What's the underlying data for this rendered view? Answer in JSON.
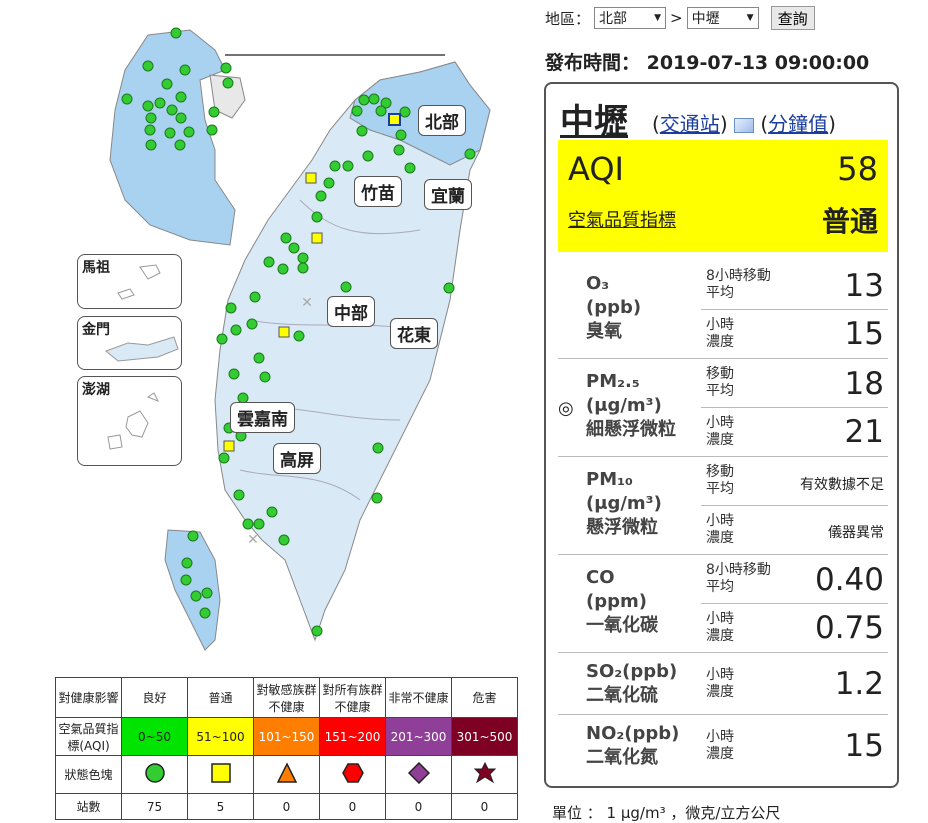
{
  "query": {
    "region_label": "地區：",
    "region_value": "北部",
    "separator": ">",
    "station_value": "中壢",
    "submit_label": "查詢"
  },
  "published": "發布時間： 2019-07-13 09:00:00",
  "map": {
    "regions": [
      "北部",
      "竹苗",
      "宜蘭",
      "中部",
      "花東",
      "雲嘉南",
      "高屏"
    ],
    "insets": [
      "馬祖",
      "金門",
      "澎湖"
    ]
  },
  "legend": {
    "header_health": "對健康影響",
    "header_aqi": "空氣品質指標(AQI)",
    "header_shape": "狀態色塊",
    "header_count": "站數",
    "levels": [
      {
        "name": "良好",
        "range": "0~50",
        "color": "#00e400",
        "shape": "circle",
        "count": "75"
      },
      {
        "name": "普通",
        "range": "51~100",
        "color": "#ffff00",
        "shape": "square",
        "count": "5"
      },
      {
        "name": "對敏感族群不健康",
        "range": "101~150",
        "color": "#ff7e00",
        "shape": "triangle",
        "count": "0"
      },
      {
        "name": "對所有族群不健康",
        "range": "151~200",
        "color": "#ff0000",
        "shape": "hexagon",
        "count": "0"
      },
      {
        "name": "非常不健康",
        "range": "201~300",
        "color": "#8f3f97",
        "shape": "diamond",
        "count": "0"
      },
      {
        "name": "危害",
        "range": "301~500",
        "color": "#7e0023",
        "shape": "star",
        "count": "0"
      }
    ]
  },
  "station": {
    "name": "中壢",
    "link_traffic": "交通站",
    "link_minute": "分鐘值",
    "aqi_label": "AQI",
    "aqi_value": "58",
    "aqi_desc": "空氣品質指標",
    "aqi_status": "普通",
    "aqi_color": "#ffff00",
    "marker": "◎",
    "pollutants": [
      {
        "name": "O₃",
        "unit": "(ppb)",
        "cname": "臭氧",
        "avg_label": "8小時移動平均",
        "avg_value": "13",
        "hour_label": "小時濃度",
        "hour_value": "15"
      },
      {
        "name": "PM₂.₅",
        "unit": "(μg/m³)",
        "cname": "細懸浮微粒",
        "avg_label": "移動平均",
        "avg_value": "18",
        "hour_label": "小時濃度",
        "hour_value": "21"
      },
      {
        "name": "PM₁₀",
        "unit": "(μg/m³)",
        "cname": "懸浮微粒",
        "avg_label": "移動平均",
        "avg_value": "有效數據不足",
        "hour_label": "小時濃度",
        "hour_value": "儀器異常"
      },
      {
        "name": "CO",
        "unit": "(ppm)",
        "cname": "一氧化碳",
        "avg_label": "8小時移動平均",
        "avg_value": "0.40",
        "hour_label": "小時濃度",
        "hour_value": "0.75"
      },
      {
        "name": "SO₂(ppb)",
        "cname": "二氧化硫",
        "hour_label": "小時濃度",
        "hour_value": "1.2"
      },
      {
        "name": "NO₂(ppb)",
        "cname": "二氧化氮",
        "hour_label": "小時濃度",
        "hour_value": "15"
      }
    ]
  },
  "unit_note": "單位 ： 1 μg/m³ ，微克/立方公尺"
}
